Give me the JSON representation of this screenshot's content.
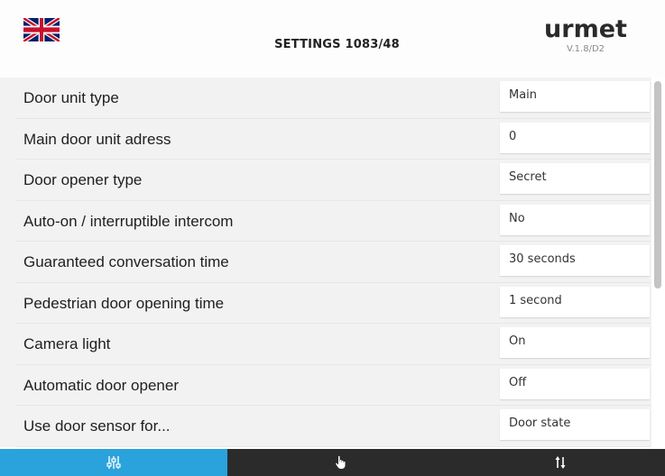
{
  "header": {
    "title": "SETTINGS 1083/48",
    "brand": "urmet",
    "version": "V.1.8/D2",
    "flag_icon": "uk-flag-icon"
  },
  "settings": [
    {
      "label": "Door unit type",
      "value": "Main"
    },
    {
      "label": "Main door unit adress",
      "value": "0"
    },
    {
      "label": "Door opener type",
      "value": "Secret"
    },
    {
      "label": "Auto-on / interruptible intercom",
      "value": "No"
    },
    {
      "label": "Guaranteed conversation time",
      "value": "30 seconds"
    },
    {
      "label": "Pedestrian door opening time",
      "value": "1 second"
    },
    {
      "label": "Camera light",
      "value": "On"
    },
    {
      "label": "Automatic door opener",
      "value": "Off"
    },
    {
      "label": "Use door sensor for...",
      "value": "Door state"
    }
  ],
  "bottom_bar": {
    "buttons": [
      {
        "icon": "sliders-icon",
        "active": true
      },
      {
        "icon": "touch-hand-icon",
        "active": false
      },
      {
        "icon": "sort-arrows-icon",
        "active": false
      }
    ]
  },
  "colors": {
    "accent": "#2aa2dc",
    "dark_bar": "#2b2b2b",
    "list_bg": "#f2f2f2"
  }
}
